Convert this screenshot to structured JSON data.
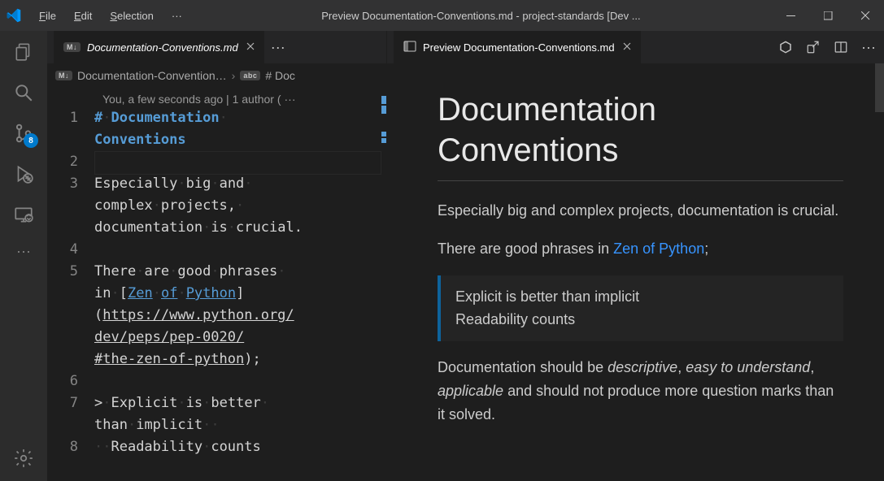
{
  "titlebar": {
    "menu": [
      "File",
      "Edit",
      "Selection",
      "···"
    ],
    "title": "Preview Documentation-Conventions.md - project-standards [Dev ...",
    "window_controls": [
      "minimize",
      "maximize",
      "close"
    ]
  },
  "activity_bar": {
    "items": [
      {
        "name": "explorer",
        "icon": "files"
      },
      {
        "name": "search",
        "icon": "search"
      },
      {
        "name": "source-control",
        "icon": "git",
        "badge": "8"
      },
      {
        "name": "run-debug",
        "icon": "bug"
      },
      {
        "name": "remote",
        "icon": "remote"
      },
      {
        "name": "overflow",
        "icon": "ellipsis"
      }
    ],
    "bottom": [
      {
        "name": "settings",
        "icon": "gear"
      }
    ]
  },
  "editors": {
    "left": {
      "tab": {
        "icon_label": "M↓",
        "title": "Documentation-Conventions.md",
        "closeable": true,
        "actions_overflow": "···"
      },
      "breadcrumb": {
        "file_icon": "M↓",
        "file": "Documentation-Convention…",
        "sep": "›",
        "sym_icon": "abc",
        "symbol": "# Doc"
      },
      "codelens": "You, a few seconds ago | 1 author (",
      "lines": [
        {
          "n": "1",
          "segments": [
            {
              "t": "#",
              "c": "md-h"
            },
            {
              "t": "·",
              "c": "ws"
            },
            {
              "t": "Documentation",
              "c": "md-h"
            },
            {
              "t": "·",
              "c": "ws"
            }
          ]
        },
        {
          "wrap": true,
          "segments": [
            {
              "t": "Conventions",
              "c": "md-h"
            }
          ]
        },
        {
          "n": "2",
          "segments": [],
          "current": true
        },
        {
          "n": "3",
          "segments": [
            {
              "t": "Especially"
            },
            {
              "t": "·",
              "c": "ws"
            },
            {
              "t": "big"
            },
            {
              "t": "·",
              "c": "ws"
            },
            {
              "t": "and"
            },
            {
              "t": "·",
              "c": "ws"
            }
          ]
        },
        {
          "wrap": true,
          "segments": [
            {
              "t": "complex"
            },
            {
              "t": "·",
              "c": "ws"
            },
            {
              "t": "projects,"
            },
            {
              "t": "·",
              "c": "ws"
            }
          ]
        },
        {
          "wrap": true,
          "segments": [
            {
              "t": "documentation"
            },
            {
              "t": "·",
              "c": "ws"
            },
            {
              "t": "is"
            },
            {
              "t": "·",
              "c": "ws"
            },
            {
              "t": "crucial."
            }
          ]
        },
        {
          "n": "4",
          "segments": []
        },
        {
          "n": "5",
          "segments": [
            {
              "t": "There"
            },
            {
              "t": "·",
              "c": "ws"
            },
            {
              "t": "are"
            },
            {
              "t": "·",
              "c": "ws"
            },
            {
              "t": "good"
            },
            {
              "t": "·",
              "c": "ws"
            },
            {
              "t": "phrases"
            },
            {
              "t": "·",
              "c": "ws"
            }
          ]
        },
        {
          "wrap": true,
          "segments": [
            {
              "t": "in"
            },
            {
              "t": "·",
              "c": "ws"
            },
            {
              "t": "["
            },
            {
              "t": "Zen",
              "c": "md-link-text"
            },
            {
              "t": "·",
              "c": "ws"
            },
            {
              "t": "of",
              "c": "md-link-text"
            },
            {
              "t": "·",
              "c": "ws"
            },
            {
              "t": "Python",
              "c": "md-link-text"
            },
            {
              "t": "]"
            }
          ]
        },
        {
          "wrap": true,
          "segments": [
            {
              "t": "("
            },
            {
              "t": "https://www.python.org/",
              "c": "md-link-url"
            }
          ]
        },
        {
          "wrap": true,
          "segments": [
            {
              "t": "dev/peps/pep-0020/",
              "c": "md-link-url"
            }
          ]
        },
        {
          "wrap": true,
          "segments": [
            {
              "t": "#the-zen-of-python",
              "c": "md-link-url"
            },
            {
              "t": ");"
            }
          ]
        },
        {
          "n": "6",
          "segments": []
        },
        {
          "n": "7",
          "segments": [
            {
              "t": ">"
            },
            {
              "t": "·",
              "c": "ws"
            },
            {
              "t": "Explicit"
            },
            {
              "t": "·",
              "c": "ws"
            },
            {
              "t": "is"
            },
            {
              "t": "·",
              "c": "ws"
            },
            {
              "t": "better"
            },
            {
              "t": "·",
              "c": "ws"
            }
          ]
        },
        {
          "wrap": true,
          "segments": [
            {
              "t": "than"
            },
            {
              "t": "·",
              "c": "ws"
            },
            {
              "t": "implicit"
            },
            {
              "t": "··",
              "c": "ws"
            }
          ]
        },
        {
          "n": "8",
          "segments": [
            {
              "t": "··",
              "c": "ws"
            },
            {
              "t": "Readability"
            },
            {
              "t": "·",
              "c": "ws"
            },
            {
              "t": "counts"
            }
          ]
        }
      ]
    },
    "right": {
      "tab": {
        "icon_label": "⧉",
        "title": "Preview Documentation-Conventions.md",
        "closeable": true
      },
      "actions": [
        {
          "name": "show-source-icon"
        },
        {
          "name": "open-changes-icon"
        },
        {
          "name": "split-editor-icon"
        },
        {
          "name": "more-actions-icon",
          "label": "···"
        }
      ],
      "preview": {
        "h1": "Documentation Conventions",
        "p1": "Especially big and complex projects, documentation is crucial.",
        "p2_prefix": "There are good phrases in ",
        "p2_link": "Zen of Python",
        "p2_suffix": ";",
        "bq_line1": "Explicit is better than implicit",
        "bq_line2": "Readability counts",
        "p3_a": "Documentation should be ",
        "p3_em1": "descriptive",
        "p3_b": ", ",
        "p3_em2": "easy to understand",
        "p3_c": ", ",
        "p3_em3": "applicable",
        "p3_d": " and should not produce more question marks than it solved."
      }
    }
  }
}
